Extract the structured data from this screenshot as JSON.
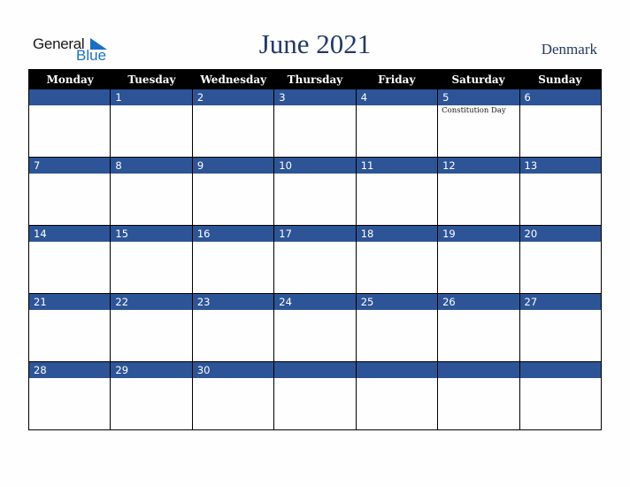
{
  "logo": {
    "line1": "General",
    "line2": "Blue",
    "icon": "triangle-flag-icon"
  },
  "title": "June 2021",
  "country": "Denmark",
  "colors": {
    "header_bg": "#000000",
    "band_bg": "#2d5496",
    "title_color": "#243a63"
  },
  "weekdays": [
    "Monday",
    "Tuesday",
    "Wednesday",
    "Thursday",
    "Friday",
    "Saturday",
    "Sunday"
  ],
  "weeks": [
    [
      {
        "day": ""
      },
      {
        "day": "1"
      },
      {
        "day": "2"
      },
      {
        "day": "3"
      },
      {
        "day": "4"
      },
      {
        "day": "5",
        "event": "Constitution Day"
      },
      {
        "day": "6"
      }
    ],
    [
      {
        "day": "7"
      },
      {
        "day": "8"
      },
      {
        "day": "9"
      },
      {
        "day": "10"
      },
      {
        "day": "11"
      },
      {
        "day": "12"
      },
      {
        "day": "13"
      }
    ],
    [
      {
        "day": "14"
      },
      {
        "day": "15"
      },
      {
        "day": "16"
      },
      {
        "day": "17"
      },
      {
        "day": "18"
      },
      {
        "day": "19"
      },
      {
        "day": "20"
      }
    ],
    [
      {
        "day": "21"
      },
      {
        "day": "22"
      },
      {
        "day": "23"
      },
      {
        "day": "24"
      },
      {
        "day": "25"
      },
      {
        "day": "26"
      },
      {
        "day": "27"
      }
    ],
    [
      {
        "day": "28"
      },
      {
        "day": "29"
      },
      {
        "day": "30"
      },
      {
        "day": ""
      },
      {
        "day": ""
      },
      {
        "day": ""
      },
      {
        "day": ""
      }
    ]
  ]
}
